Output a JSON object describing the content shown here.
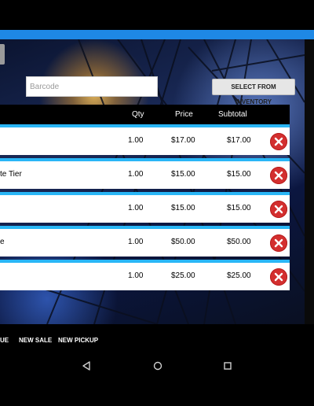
{
  "search": {
    "barcode_placeholder": "Barcode"
  },
  "toolbar": {
    "select_inventory_label": "SELECT FROM INVENTORY"
  },
  "table": {
    "headers": {
      "qty": "Qty",
      "price": "Price",
      "subtotal": "Subtotal"
    },
    "rows": [
      {
        "name": "",
        "qty": "1.00",
        "price": "$17.00",
        "subtotal": "$17.00"
      },
      {
        "name": "te Tier",
        "qty": "1.00",
        "price": "$15.00",
        "subtotal": "$15.00"
      },
      {
        "name": "",
        "qty": "1.00",
        "price": "$15.00",
        "subtotal": "$15.00"
      },
      {
        "name": "e",
        "qty": "1.00",
        "price": "$50.00",
        "subtotal": "$50.00"
      },
      {
        "name": "",
        "qty": "1.00",
        "price": "$25.00",
        "subtotal": "$25.00"
      }
    ],
    "remove_icon": "close-icon"
  },
  "bottom_actions": {
    "continue_fragment": "UE",
    "new_sale": "NEW SALE",
    "new_pickup": "NEW PICKUP"
  },
  "nav": {
    "back_icon": "back-triangle-icon",
    "home_icon": "home-circle-icon",
    "recents_icon": "recents-square-icon"
  },
  "colors": {
    "accent_blue": "#1e88e5",
    "row_accent": "#29b6f6",
    "remove_red": "#d32f2f"
  }
}
